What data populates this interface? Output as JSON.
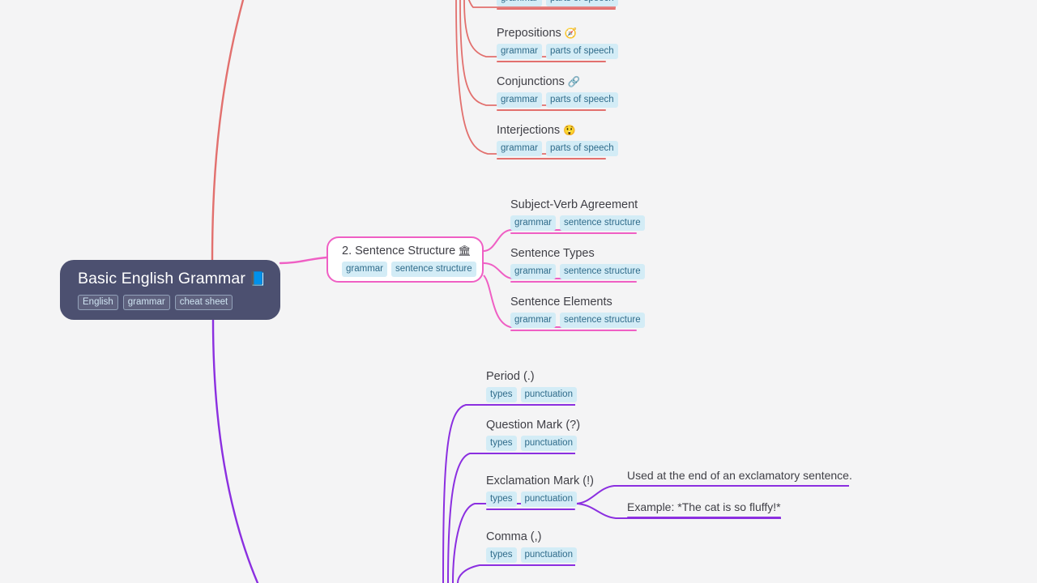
{
  "canvas": {
    "background": "#f4f4f5",
    "type": "mindmap"
  },
  "root": {
    "title": "Basic English Grammar",
    "emoji": "📘",
    "emoji_name": "blue-book-icon",
    "background": "#4c5070",
    "text_color": "#ffffff",
    "tags": [
      "English",
      "grammar",
      "cheat sheet"
    ]
  },
  "branches": {
    "parts_of_speech": {
      "accent": "#e2706e",
      "note": "branch partially cut off above the viewport",
      "leaves": [
        {
          "title": "",
          "emoji": "",
          "tags": [
            "grammar",
            "parts of speech"
          ]
        },
        {
          "title": "Prepositions",
          "emoji": "🧭",
          "emoji_name": "compass-icon",
          "tags": [
            "grammar",
            "parts of speech"
          ]
        },
        {
          "title": "Conjunctions",
          "emoji": "🔗",
          "emoji_name": "link-icon",
          "tags": [
            "grammar",
            "parts of speech"
          ]
        },
        {
          "title": "Interjections",
          "emoji": "😲",
          "emoji_name": "astonished-face-icon",
          "tags": [
            "grammar",
            "parts of speech"
          ]
        }
      ]
    },
    "sentence_structure": {
      "accent": "#ef5fc4",
      "node": {
        "title": "2. Sentence Structure",
        "emoji": "🏛",
        "emoji_name": "classical-building-icon",
        "tags": [
          "grammar",
          "sentence structure"
        ]
      },
      "leaves": [
        {
          "title": "Subject-Verb Agreement",
          "tags": [
            "grammar",
            "sentence structure"
          ]
        },
        {
          "title": "Sentence Types",
          "tags": [
            "grammar",
            "sentence structure"
          ]
        },
        {
          "title": "Sentence Elements",
          "tags": [
            "grammar",
            "sentence structure"
          ]
        }
      ]
    },
    "punctuation": {
      "accent": "#8b2fe0",
      "leaves": [
        {
          "title": "Period (.)",
          "tags": [
            "types",
            "punctuation"
          ]
        },
        {
          "title": "Question Mark (?)",
          "tags": [
            "types",
            "punctuation"
          ]
        },
        {
          "title": "Exclamation Mark (!)",
          "tags": [
            "types",
            "punctuation"
          ]
        },
        {
          "title": "Comma (,)",
          "tags": [
            "types",
            "punctuation"
          ]
        }
      ],
      "details": [
        {
          "title": "Used at the end of an exclamatory sentence."
        },
        {
          "title": "Example: *The cat is so fluffy!*"
        }
      ]
    }
  }
}
